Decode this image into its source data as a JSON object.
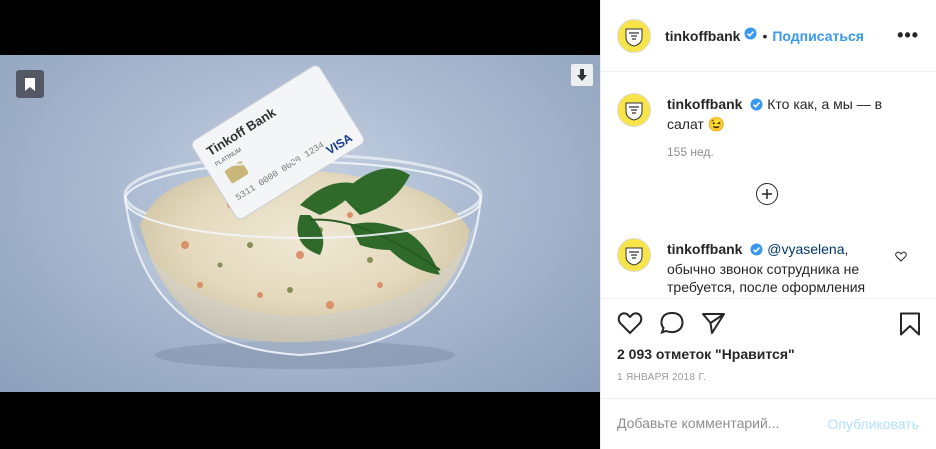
{
  "post": {
    "username": "tinkoffbank",
    "follow_label": "Подписаться",
    "dot": "•",
    "more_label": "•••",
    "caption": {
      "username": "tinkoffbank",
      "text": "Кто как, а мы — в салат 😉",
      "time": "155 нед."
    },
    "reply": {
      "username": "tinkoffbank",
      "mention": "@vyaselena",
      "text": ", обычно звонок сотрудника не требуется, после оформления"
    },
    "likes": "2 093 отметок \"Нравится\"",
    "date": "1 ЯНВАРЯ 2018 Г.",
    "comment_placeholder": "Добавьте комментарий...",
    "publish_label": "Опубликовать"
  },
  "card": {
    "brand": "Tinkoff Bank",
    "tier": "PLATINUM",
    "network": "VISA",
    "number": "5311 0000 0000 1234"
  },
  "icons": {
    "bookmark_badge": "bookmark-icon",
    "download": "download-icon",
    "heart": "heart-icon",
    "comment": "comment-icon",
    "share": "share-icon",
    "save": "save-icon",
    "plus": "plus-circle-icon",
    "verified": "verified-icon"
  },
  "colors": {
    "accent": "#3897f0",
    "mention": "#003569",
    "avatar_bg": "#f7e34a",
    "publish_disabled": "#b2dffc"
  }
}
